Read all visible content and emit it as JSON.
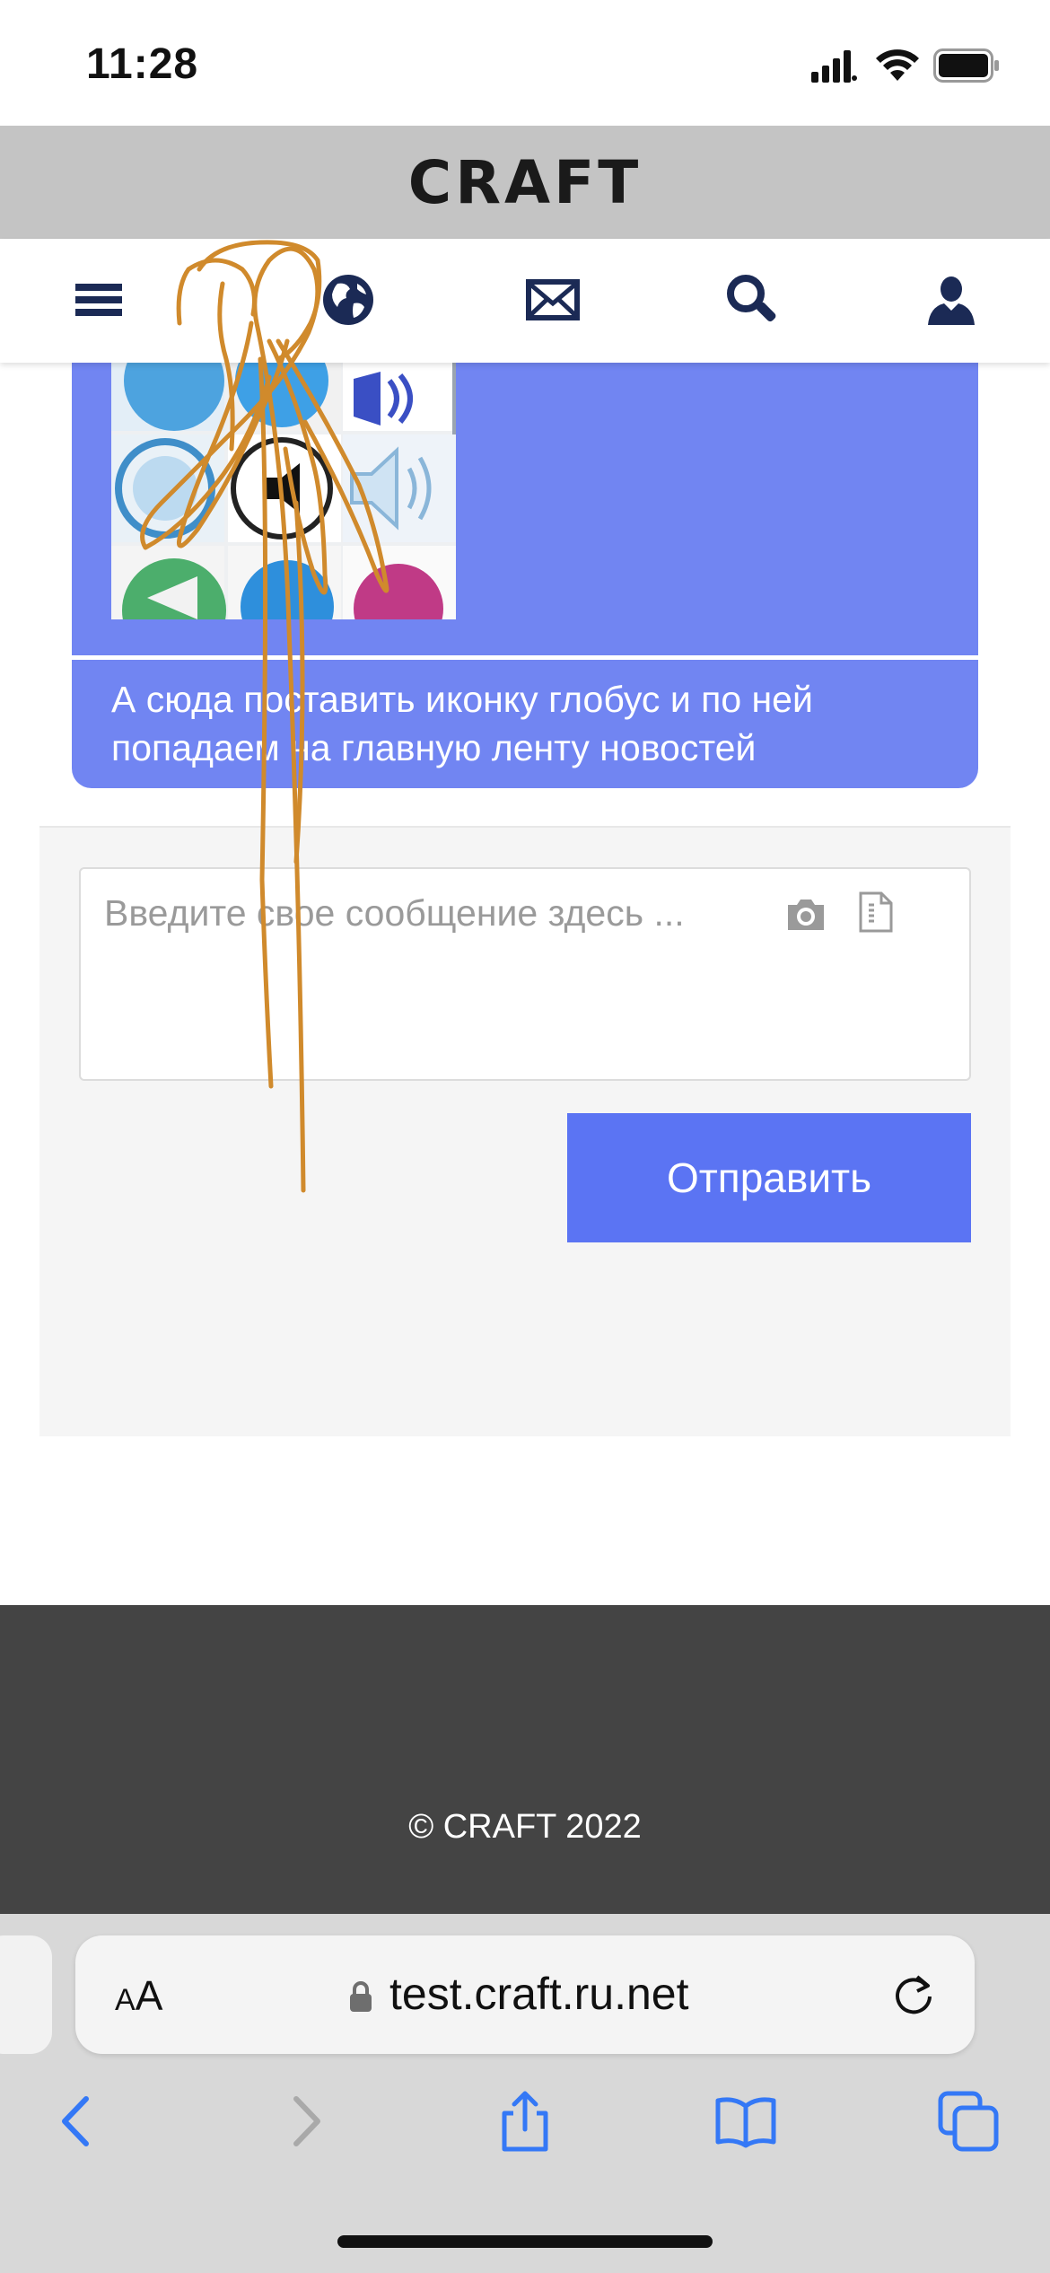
{
  "status_bar": {
    "time": "11:28"
  },
  "site": {
    "logo": "CRAFT"
  },
  "nav": {
    "items": [
      {
        "icon": "hamburger-menu-icon"
      },
      {
        "icon": "globe-icon"
      },
      {
        "icon": "envelope-icon"
      },
      {
        "icon": "search-icon"
      },
      {
        "icon": "user-icon"
      }
    ]
  },
  "card": {
    "text": "А сюда поставить иконку глобус и по ней попадаем на главную ленту новостей",
    "background": "#7185f2"
  },
  "compose": {
    "placeholder": "Введите свое сообщение здесь ...",
    "send_label": "Отправить",
    "button_color": "#5b74f3"
  },
  "footer": {
    "copyright": "© CRAFT 2022"
  },
  "browser": {
    "aa_label": "AA",
    "url": "test.craft.ru.net",
    "toolbar": [
      {
        "icon": "back-chevron-icon"
      },
      {
        "icon": "forward-chevron-icon"
      },
      {
        "icon": "share-icon"
      },
      {
        "icon": "bookmarks-icon"
      },
      {
        "icon": "tabs-icon"
      }
    ]
  },
  "annotation": {
    "stroke_color": "#d08a2c"
  }
}
